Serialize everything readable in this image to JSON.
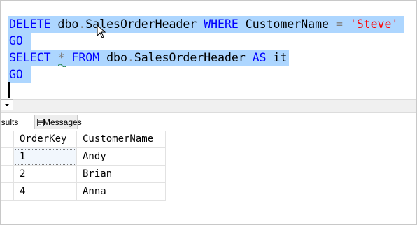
{
  "editor": {
    "lines": [
      {
        "tokens": [
          {
            "cls": "kw",
            "text": "DELETE"
          },
          {
            "cls": "id",
            "text": " dbo"
          },
          {
            "cls": "op",
            "text": "."
          },
          {
            "cls": "id",
            "text": "SalesOrderHeader "
          },
          {
            "cls": "kw",
            "text": "WHERE"
          },
          {
            "cls": "id",
            "text": " CustomerName "
          },
          {
            "cls": "op",
            "text": "="
          },
          {
            "cls": "id",
            "text": " "
          },
          {
            "cls": "str",
            "text": "'Steve'"
          }
        ]
      },
      {
        "tokens": [
          {
            "cls": "kw",
            "text": "GO"
          }
        ]
      },
      {
        "tokens": [
          {
            "cls": "kw",
            "text": "SELECT"
          },
          {
            "cls": "id",
            "text": " "
          },
          {
            "cls": "op",
            "text": "*"
          },
          {
            "cls": "id",
            "text": " "
          },
          {
            "cls": "kw",
            "text": "FROM"
          },
          {
            "cls": "id",
            "text": " dbo"
          },
          {
            "cls": "op",
            "text": "."
          },
          {
            "cls": "id",
            "text": "SalesOrderHeader "
          },
          {
            "cls": "kw",
            "text": "AS"
          },
          {
            "cls": "id",
            "text": " it"
          }
        ]
      },
      {
        "tokens": [
          {
            "cls": "kw",
            "text": "GO"
          }
        ]
      }
    ],
    "selection_color": "#add6ff"
  },
  "tabs": {
    "results_label": "esults",
    "messages_label": "Messages"
  },
  "grid": {
    "columns": [
      "OrderKey",
      "CustomerName"
    ],
    "rows": [
      [
        "1",
        "Andy"
      ],
      [
        "2",
        "Brian"
      ],
      [
        "4",
        "Anna"
      ]
    ]
  }
}
